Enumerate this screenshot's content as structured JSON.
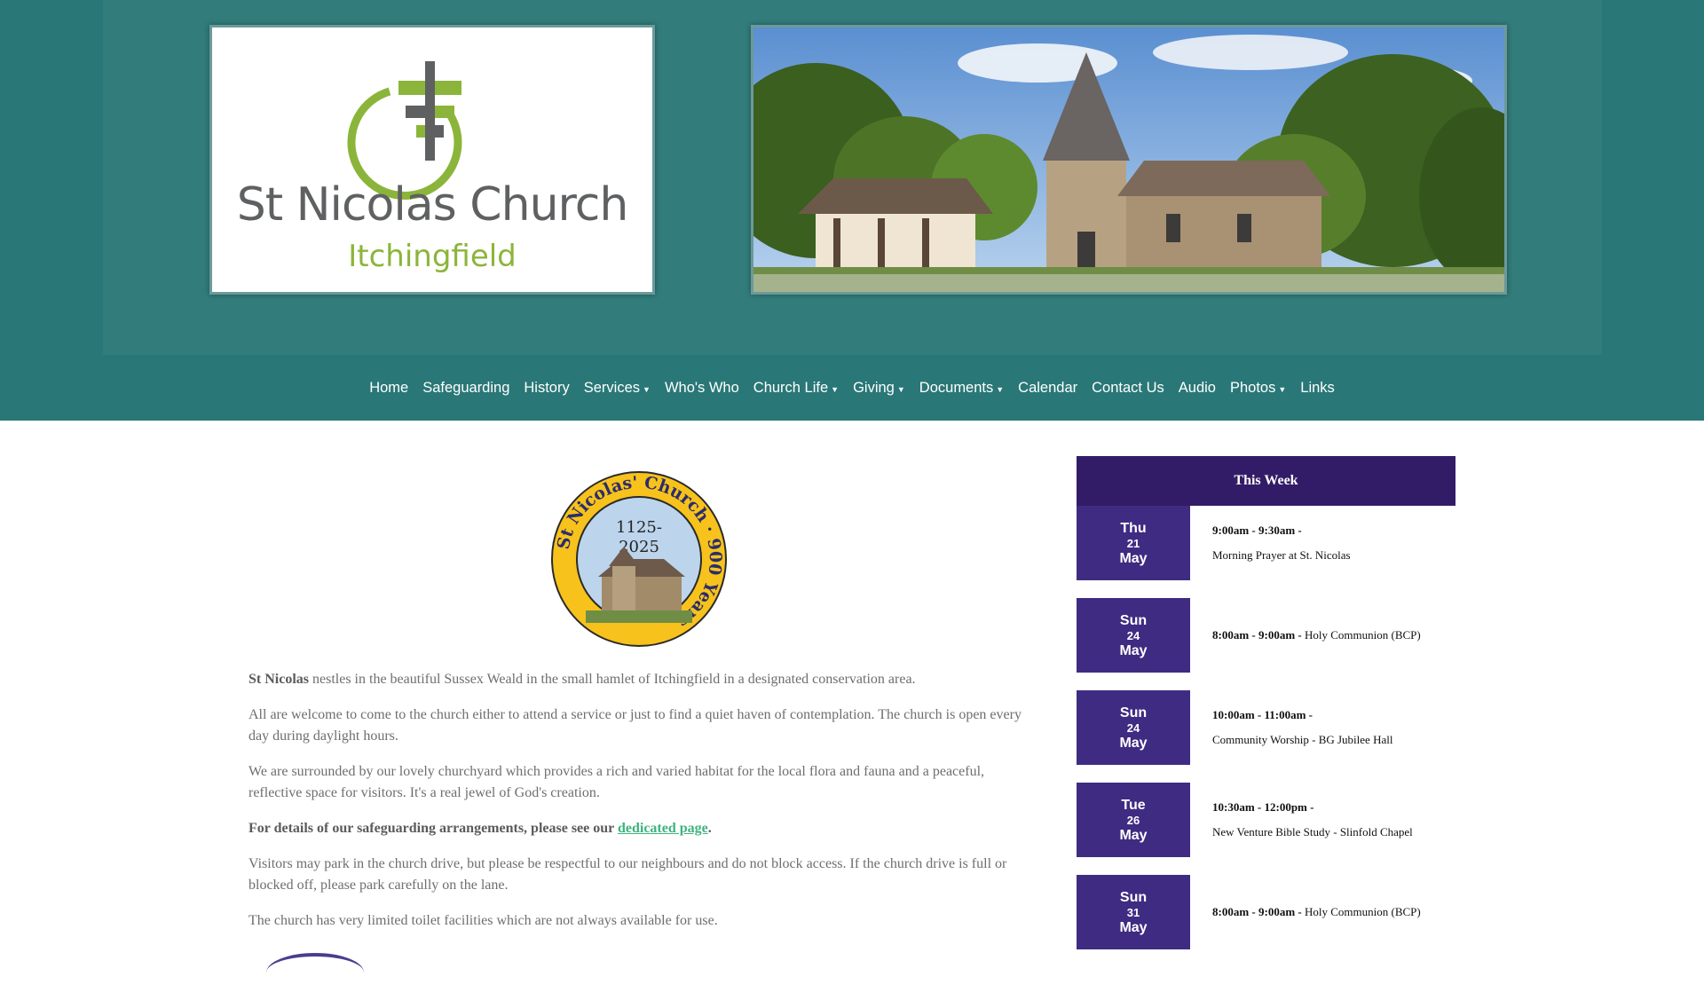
{
  "logo": {
    "title": "St Nicolas Church",
    "subtitle": "Itchingfield"
  },
  "nav": {
    "items": [
      {
        "label": "Home",
        "dropdown": false
      },
      {
        "label": "Safeguarding",
        "dropdown": false
      },
      {
        "label": "History",
        "dropdown": false
      },
      {
        "label": "Services",
        "dropdown": true
      },
      {
        "label": "Who's Who",
        "dropdown": false
      },
      {
        "label": "Church Life",
        "dropdown": true
      },
      {
        "label": "Giving",
        "dropdown": true
      },
      {
        "label": "Documents",
        "dropdown": true
      },
      {
        "label": "Calendar",
        "dropdown": false
      },
      {
        "label": "Contact Us",
        "dropdown": false
      },
      {
        "label": "Audio",
        "dropdown": false
      },
      {
        "label": "Photos",
        "dropdown": true
      },
      {
        "label": "Links",
        "dropdown": false
      }
    ],
    "caret": "▼"
  },
  "badge": {
    "ring_text": "St Nicolas' Church · 900 Years",
    "years": "1125-",
    "years2": "2025"
  },
  "content": {
    "p1_bold": "St Nicolas",
    "p1_rest": " nestles in the beautiful Sussex Weald in the small hamlet of Itchingfield in a designated conservation area.",
    "p2": "All are welcome to come to the church either to attend a service or just to find a quiet haven of contemplation. The church is open every day during daylight hours.",
    "p3": "We are surrounded by our lovely churchyard which provides a rich and varied habitat for the local flora and fauna and a peaceful, reflective space for visitors. It's a real jewel of God's creation.",
    "p4_bold": "For details of our safeguarding arrangements, please see our ",
    "p4_link": "dedicated page",
    "p4_end": ".",
    "p5": "Visitors may park in the church drive, but please be respectful to our neighbours and do not block access. If the church drive is full or blocked off, please park carefully on the lane.",
    "p6": "The church has very limited toilet facilities which are not always available for use."
  },
  "this_week": {
    "title": "This Week",
    "events": [
      {
        "day": "Thu",
        "date": "21",
        "month": "May",
        "time": "9:00am - 9:30am -",
        "desc": "Morning Prayer at St. Nicolas",
        "inline": false
      },
      {
        "day": "Sun",
        "date": "24",
        "month": "May",
        "time": "8:00am - 9:00am -",
        "desc": " Holy Communion (BCP)",
        "inline": true
      },
      {
        "day": "Sun",
        "date": "24",
        "month": "May",
        "time": "10:00am - 11:00am -",
        "desc": "Community Worship - BG Jubilee Hall",
        "inline": false
      },
      {
        "day": "Tue",
        "date": "26",
        "month": "May",
        "time": "10:30am - 12:00pm -",
        "desc": "New Venture Bible Study - Slinfold Chapel",
        "inline": false
      },
      {
        "day": "Sun",
        "date": "31",
        "month": "May",
        "time": "8:00am - 9:00am -",
        "desc": " Holy Communion (BCP)",
        "inline": true
      }
    ]
  },
  "colors": {
    "teal_band": "#2a7777",
    "teal_panel": "#327c7c",
    "purple_header": "#331c67",
    "purple_date": "#3f2b82",
    "link_green": "#3fb27f",
    "logo_green": "#8bb53a"
  }
}
